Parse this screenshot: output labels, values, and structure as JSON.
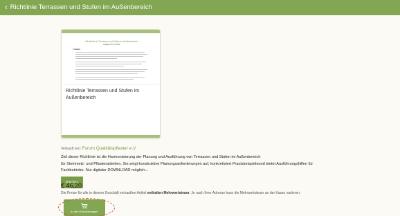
{
  "header": {
    "back_icon": "chevron-left-icon",
    "title": "Richtlinie Terrassen und Stufen im Außenbereich"
  },
  "product": {
    "thumbnail": {
      "doc_title": "»Richtlinie für Terrassen und Stufen im Außenbereich«",
      "doc_subtitle": "Ausgabe 01 / 05. 2022",
      "doc_heading": "1  Vorwort"
    },
    "name": "Richtlinie Terrassen und Stufen im Außenbereich"
  },
  "seller": {
    "prefix": "Verkauft von:",
    "name": "Forum Qualitätspflaster e.V."
  },
  "description": {
    "line1": "Ziel dieser Richtlinie ist die Harmonisierung der Planung und Ausführung von Terrassen und Stufen im Außenbereich",
    "line2": "für Steinmetz- und Pflasterarbeiten. Sie zeigt konstruktive Planungsanforderungen auf, konkretisiert Praxisbeispieleund bietet Ausführungshilfen für",
    "line3": "Fachbetriebe. Nur digitaler DOWNLOAD möglich..."
  },
  "badge": {
    "label": "DIGITAL"
  },
  "price": {
    "value": "€ 46,20",
    "note_before": "Die Preise für alle in diesem Geschäft verkauften Artikel",
    "note_bold": "enthalten Mehrwertsteuer",
    "note_after": ". Je nach Ihrer Adresse kann die Mehrwertsteuer an der Kasse variieren."
  },
  "cart_button": {
    "icon": "shopping-cart-icon",
    "label": "In den Einkaufswagen"
  },
  "colors": {
    "header_bg": "#83a653",
    "accent": "#7a9b47",
    "highlight": "#d8514a"
  }
}
